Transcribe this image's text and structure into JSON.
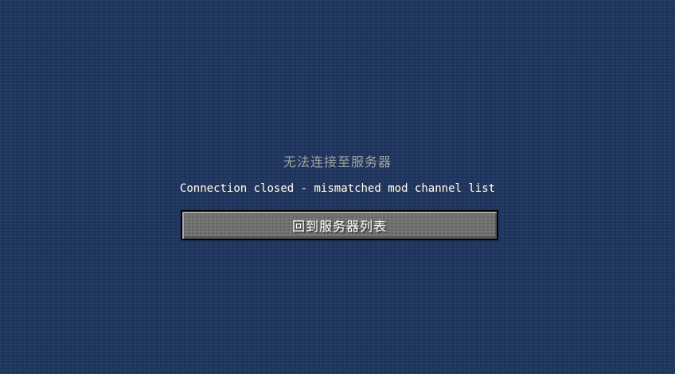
{
  "screen": {
    "title": "无法连接至服务器",
    "message": "Connection closed - mismatched mod channel list",
    "back_button_label": "回到服务器列表"
  },
  "colors": {
    "background": "#1e355f",
    "title_text": "#a3a3a3",
    "message_text": "#ffffff",
    "button_fill": "#6f6f6f",
    "button_border": "#000000"
  }
}
